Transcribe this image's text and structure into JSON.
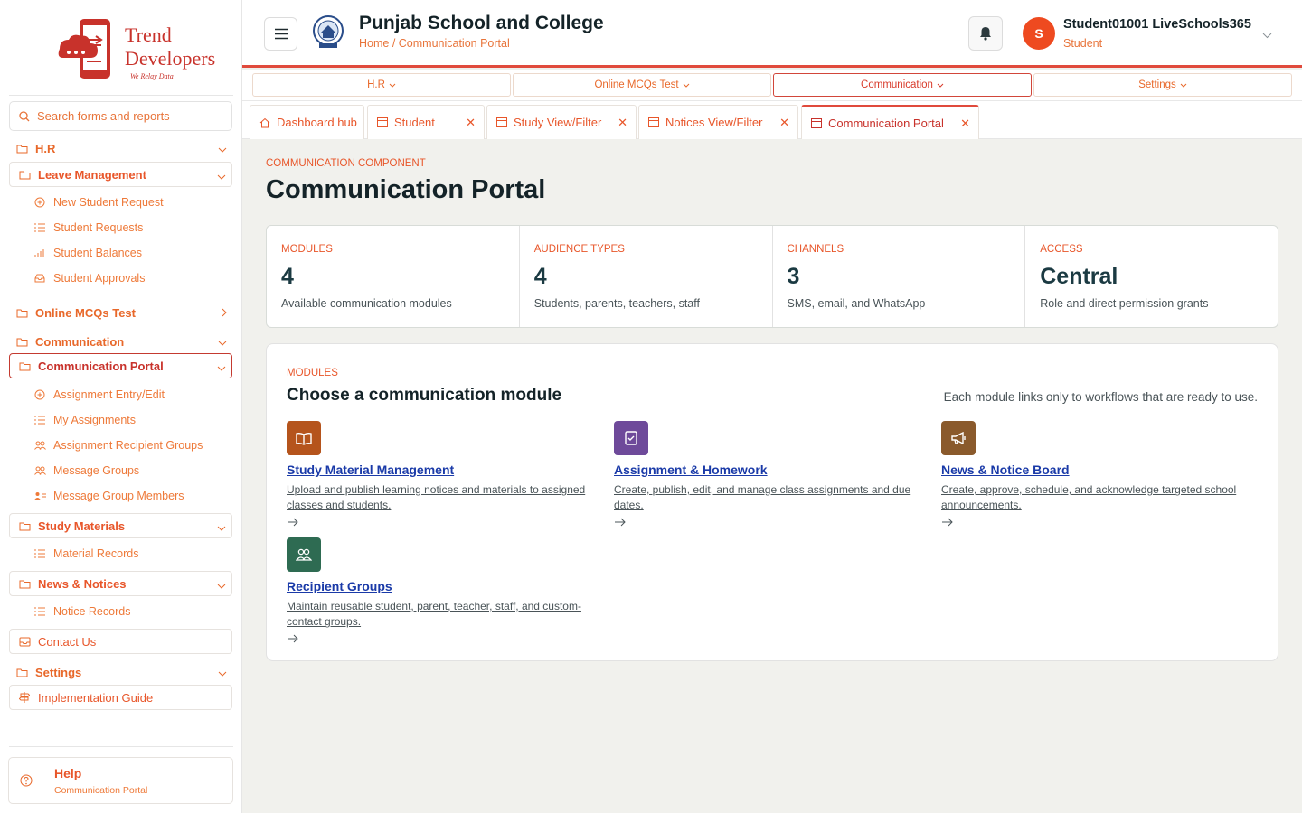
{
  "brand": {
    "line1": "Trend",
    "line2": "Developers",
    "tagline": "We Relay Data"
  },
  "search": {
    "placeholder": "Search forms and reports"
  },
  "sidebar": {
    "hr": "H.R",
    "leave_management": "Leave Management",
    "leave_items": [
      "New Student Request",
      "Student Requests",
      "Student Balances",
      "Student Approvals"
    ],
    "online_mcqs": "Online MCQs Test",
    "communication": "Communication",
    "communication_portal": "Communication Portal",
    "portal_items": [
      "Assignment Entry/Edit",
      "My Assignments",
      "Assignment Recipient Groups",
      "Message Groups",
      "Message Group Members"
    ],
    "study_materials": "Study Materials",
    "material_records": "Material Records",
    "news_notices": "News & Notices",
    "notice_records": "Notice Records",
    "contact_us": "Contact Us",
    "settings": "Settings",
    "implementation_guide": "Implementation Guide",
    "help_title": "Help",
    "help_sub": "Communication Portal"
  },
  "header": {
    "school": "Punjab School and College",
    "breadcrumb": "Home / Communication Portal",
    "user_initial": "S",
    "user_name": "Student01001 LiveSchools365",
    "user_role": "Student"
  },
  "menu": [
    "H.R",
    "Online MCQs Test",
    "Communication",
    "Settings"
  ],
  "tabs": [
    "Dashboard hub",
    "Student",
    "Study View/Filter",
    "Notices View/Filter",
    "Communication Portal"
  ],
  "page": {
    "eyebrow": "COMMUNICATION COMPONENT",
    "title": "Communication Portal"
  },
  "stats": [
    {
      "label": "MODULES",
      "value": "4",
      "desc": "Available communication modules"
    },
    {
      "label": "AUDIENCE TYPES",
      "value": "4",
      "desc": "Students, parents, teachers, staff"
    },
    {
      "label": "CHANNELS",
      "value": "3",
      "desc": "SMS, email, and WhatsApp"
    },
    {
      "label": "ACCESS",
      "value": "Central",
      "desc": "Role and direct permission grants"
    }
  ],
  "modules": {
    "eyebrow": "MODULES",
    "title": "Choose a communication module",
    "note": "Each module links only to workflows that are ready to use.",
    "items": [
      {
        "title": "Study Material Management",
        "desc": "Upload and publish learning notices and materials to assigned classes and students.",
        "color": "#b5541c",
        "icon": "book-icon"
      },
      {
        "title": "Assignment & Homework",
        "desc": "Create, publish, edit, and manage class assignments and due dates.",
        "color": "#6e4a9a",
        "icon": "checklist-icon"
      },
      {
        "title": "News & Notice Board",
        "desc": "Create, approve, schedule, and acknowledge targeted school announcements.",
        "color": "#8a5a2c",
        "icon": "megaphone-icon"
      },
      {
        "title": "Recipient Groups",
        "desc": "Maintain reusable student, parent, teacher, staff, and custom-contact groups.",
        "color": "#2e6b52",
        "icon": "people-icon"
      }
    ]
  },
  "colors": {
    "accent": "#e8562a",
    "header_border": "#e04a3c",
    "link": "#1a3aa8"
  }
}
